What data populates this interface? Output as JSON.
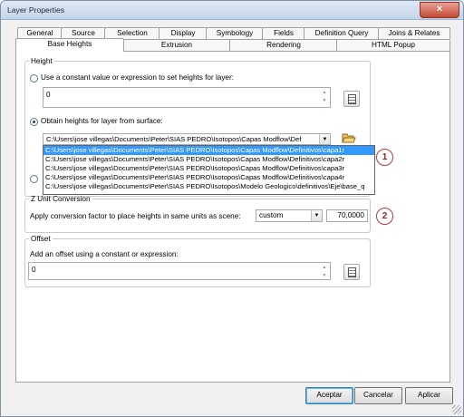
{
  "window": {
    "title": "Layer Properties",
    "close_glyph": "×"
  },
  "tabs": {
    "row1": [
      "General",
      "Source",
      "Selection",
      "Display",
      "Symbology",
      "Fields",
      "Definition Query",
      "Joins & Relates"
    ],
    "row2": [
      "Base Heights",
      "Extrusion",
      "Rendering",
      "HTML Popup"
    ],
    "active": "Base Heights"
  },
  "height": {
    "legend": "Height",
    "constant_label": "Use a constant value or expression to set heights for layer:",
    "constant_value": "0",
    "surface_label": "Obtain heights for layer from surface:",
    "surface_selected": "C:\\Users\\jose villegas\\Documents\\Peter\\SIAS PEDRO\\Isotopos\\Capas Modflow\\Def",
    "surface_options": [
      "C:\\Users\\jose villegas\\Documents\\Peter\\SIAS PEDRO\\Isotopos\\Capas Modflow\\Definitivos\\capa1r",
      "C:\\Users\\jose villegas\\Documents\\Peter\\SIAS PEDRO\\Isotopos\\Capas Modflow\\Definitivos\\capa2r",
      "C:\\Users\\jose villegas\\Documents\\Peter\\SIAS PEDRO\\Isotopos\\Capas Modflow\\Definitivos\\capa3r",
      "C:\\Users\\jose villegas\\Documents\\Peter\\SIAS PEDRO\\Isotopos\\Capas Modflow\\Definitivos\\capa4r",
      "C:\\Users\\jose villegas\\Documents\\Peter\\SIAS PEDRO\\Isotopos\\Modelo Geologico\\definitivos\\Eje\\base_q"
    ]
  },
  "z_unit": {
    "legend": "Z Unit Conversion",
    "label": "Apply conversion factor to place heights in same units as scene:",
    "unit": "custom",
    "factor": "70,0000"
  },
  "offset": {
    "legend": "Offset",
    "label": "Add an offset using a constant or expression:",
    "value": "0"
  },
  "callouts": [
    "1",
    "2"
  ],
  "buttons": {
    "ok": "Aceptar",
    "cancel": "Cancelar",
    "apply": "Aplicar"
  },
  "icons": [
    "close-icon",
    "calculator-icon",
    "open-folder-icon",
    "dropdown-arrow-icon",
    "spinner-arrows-icon",
    "resize-grip-icon"
  ]
}
